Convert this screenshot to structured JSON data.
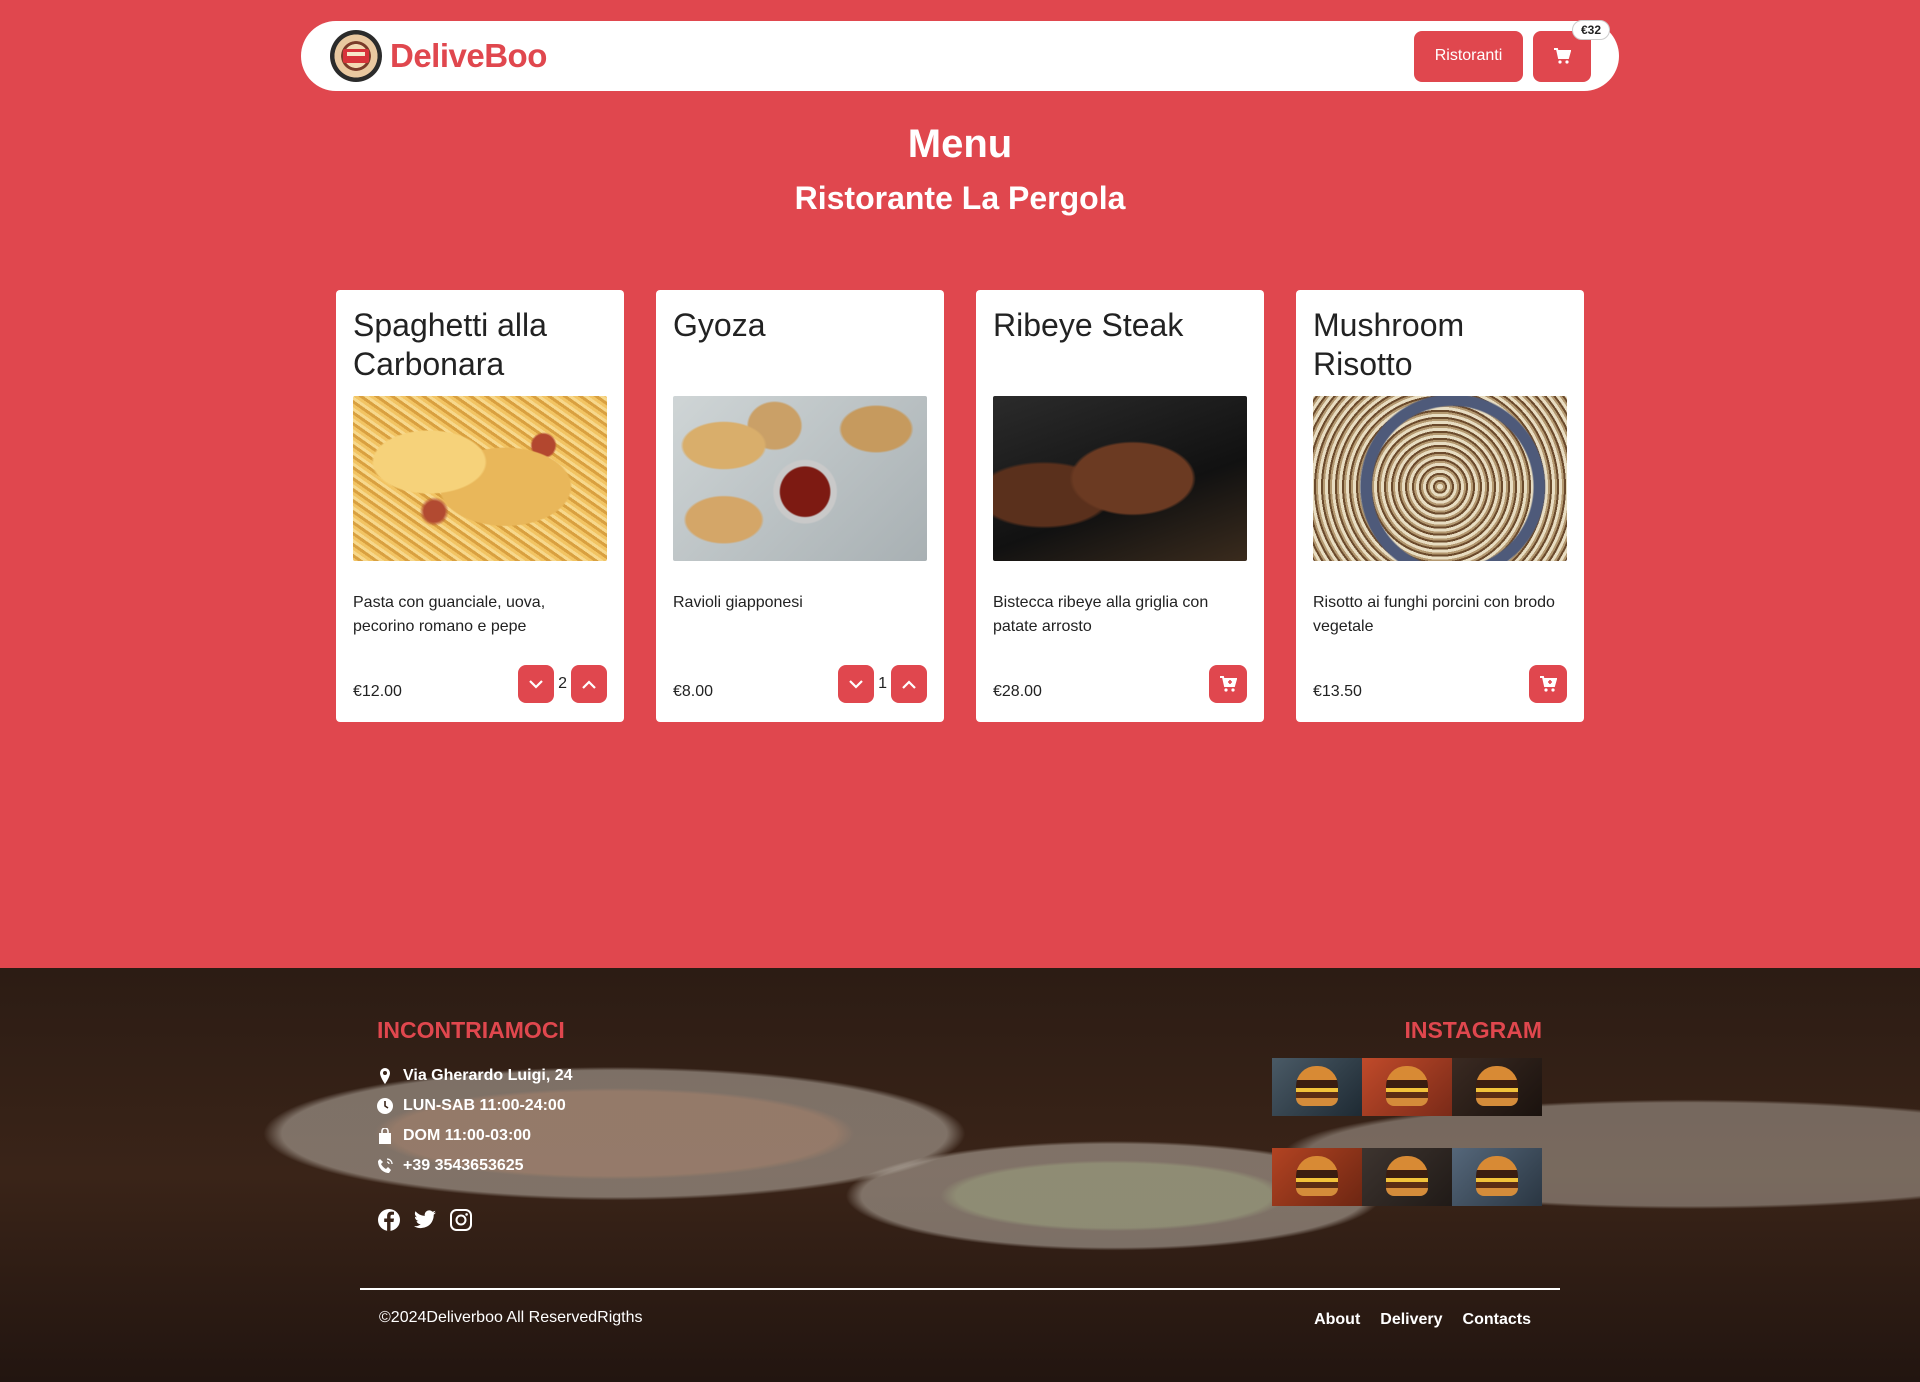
{
  "navbar": {
    "brand": "DeliveBoo",
    "restaurants_label": "Ristoranti",
    "cart_total": "€32"
  },
  "page": {
    "title": "Menu",
    "restaurant": "Ristorante La Pergola"
  },
  "dishes": [
    {
      "name": "Spaghetti alla Carbonara",
      "description": "Pasta con guanciale, uova, pecorino romano e pepe",
      "price": "€12.00",
      "quantity": "2"
    },
    {
      "name": "Gyoza",
      "description": "Ravioli giapponesi",
      "price": "€8.00",
      "quantity": "1"
    },
    {
      "name": "Ribeye Steak",
      "description": "Bistecca ribeye alla griglia con patate arrosto",
      "price": "€28.00",
      "quantity": null
    },
    {
      "name": "Mushroom Risotto",
      "description": "Risotto ai funghi porcini con brodo vegetale",
      "price": "€13.50",
      "quantity": null
    }
  ],
  "footer": {
    "contact_heading": "INCONTRIAMOCI",
    "address": "Via Gherardo Luigi, 24",
    "hours_weekdays": "LUN-SAB 11:00-24:00",
    "hours_sunday": "DOM 11:00-03:00",
    "phone": "+39 3543653625",
    "instagram_heading": "INSTAGRAM",
    "copyright": "©2024Deliverboo All ReservedRigths",
    "links": {
      "about": "About",
      "delivery": "Delivery",
      "contacts": "Contacts"
    }
  },
  "colors": {
    "primary": "#e0474e",
    "card_bg": "#ffffff",
    "text": "#222222"
  },
  "icons": [
    "cart-icon",
    "chevron-down-icon",
    "chevron-up-icon",
    "add-to-cart-icon",
    "map-pin-icon",
    "clock-icon",
    "bag-icon",
    "phone-icon",
    "facebook-icon",
    "twitter-icon",
    "instagram-icon"
  ]
}
